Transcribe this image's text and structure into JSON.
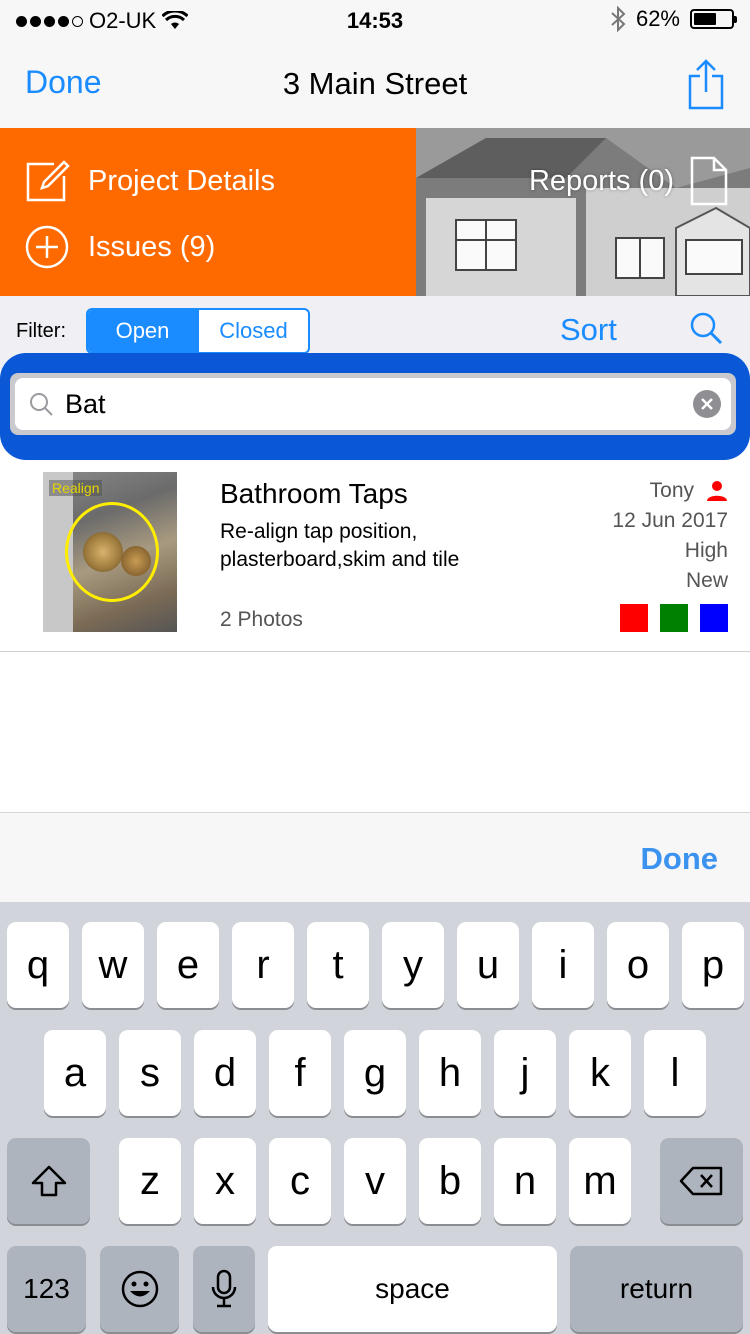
{
  "status_bar": {
    "carrier": "O2-UK",
    "time": "14:53",
    "battery": "62%",
    "battery_level": 0.62,
    "signal_bars": 4,
    "icons": [
      "wifi-icon",
      "bluetooth-icon",
      "battery-icon"
    ]
  },
  "nav": {
    "done_label": "Done",
    "title": "3 Main Street",
    "share_icon": "share-icon"
  },
  "tiles": {
    "project_details": "Project Details",
    "issues": "Issues (9)",
    "reports": "Reports (0)"
  },
  "filter": {
    "label": "Filter:",
    "options": [
      "Open",
      "Closed"
    ],
    "selected": "Open",
    "sort_label": "Sort"
  },
  "search": {
    "value": "Bat",
    "placeholder": "Search"
  },
  "issues": [
    {
      "title": "Bathroom Taps",
      "description": "Re-align tap position, plasterboard,skim and tile",
      "photos": "2 Photos",
      "thumb_tag": "Realign",
      "assignee": "Tony",
      "date": "12 Jun 2017",
      "priority": "High",
      "status": "New",
      "tags": [
        "#ff0000",
        "#008000",
        "#0000ff"
      ]
    }
  ],
  "keyboard_toolbar": {
    "done_label": "Done"
  },
  "keyboard": {
    "row1": [
      "q",
      "w",
      "e",
      "r",
      "t",
      "y",
      "u",
      "i",
      "o",
      "p"
    ],
    "row2": [
      "a",
      "s",
      "d",
      "f",
      "g",
      "h",
      "j",
      "k",
      "l"
    ],
    "row3": [
      "z",
      "x",
      "c",
      "v",
      "b",
      "n",
      "m"
    ],
    "numbers_label": "123",
    "space_label": "space",
    "return_label": "return"
  },
  "colors": {
    "accent": "#1a8cff",
    "tile_orange": "#ff6a00",
    "search_highlight": "#0a58d6"
  }
}
